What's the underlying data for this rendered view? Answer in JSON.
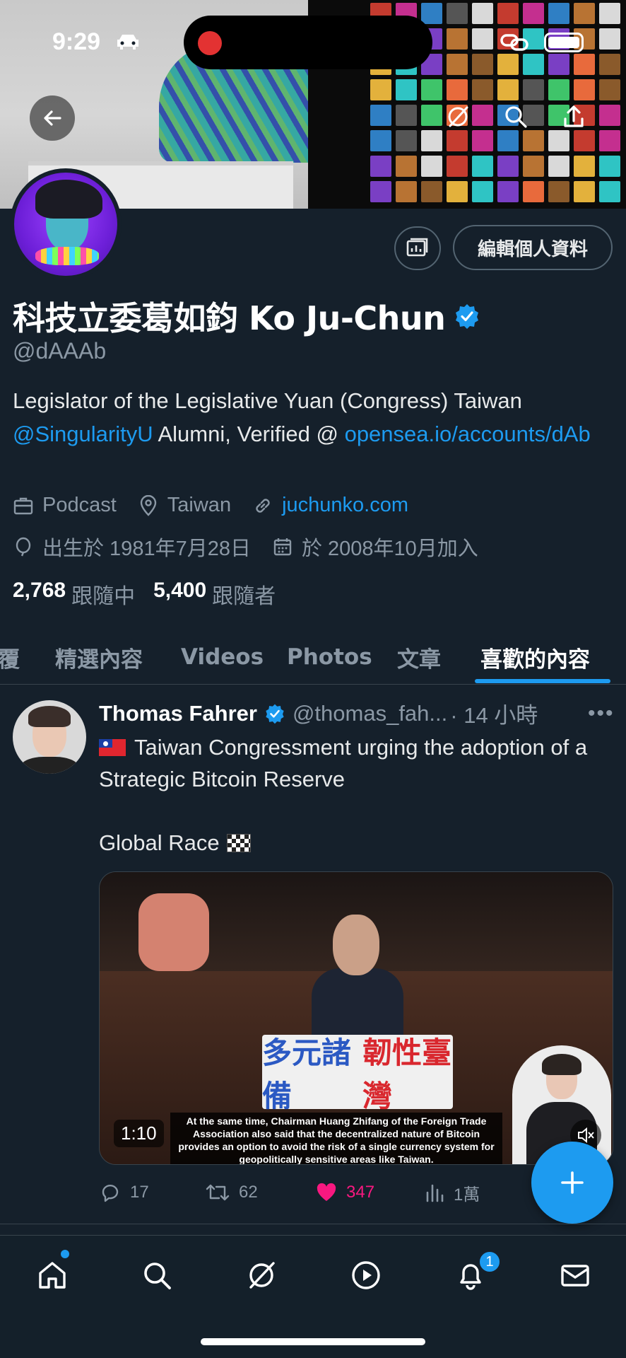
{
  "status_bar": {
    "time": "9:29"
  },
  "profile": {
    "name": "科技立委葛如鈞 Ko Ju-Chun",
    "handle": "@dAAAb",
    "edit_label": "編輯個人資料",
    "bio_part1": "Legislator of the Legislative Yuan (Congress) Taiwan ",
    "bio_mention": "@SingularityU",
    "bio_part2": " Alumni, Verified @ ",
    "bio_link": "opensea.io/accounts/dAb",
    "category": "Podcast",
    "location": "Taiwan",
    "website": "juchunko.com",
    "birthday": "出生於 1981年7月28日",
    "joined": "於 2008年10月加入",
    "following_count": "2,768",
    "following_label": "跟隨中",
    "followers_count": "5,400",
    "followers_label": "跟隨者"
  },
  "tabs": [
    "回覆",
    "精選內容",
    "Videos",
    "Photos",
    "文章",
    "喜歡的內容"
  ],
  "active_tab": "喜歡的內容",
  "tweet": {
    "author_name": "Thomas Fahrer",
    "author_handle": "@thomas_fah...",
    "time": "· 14 小時",
    "text_line1": "Taiwan Congressment urging the adoption of a Strategic Bitcoin Reserve",
    "text_line2": "Global Race",
    "video": {
      "duration": "1:10",
      "sign_left": "多元諸備",
      "sign_right": "韌性臺灣",
      "caption": "At the same time, Chairman Huang Zhifang of the Foreign Trade Association also said that the decentralized nature of Bitcoin provides an option to avoid the risk of a single currency system for geopolitically sensitive areas like Taiwan."
    },
    "replies": "17",
    "retweets": "62",
    "likes": "347",
    "views": "1萬"
  },
  "notifications_badge": "1",
  "colors": {
    "background": "#15202b",
    "accent": "#1d9bf0",
    "like": "#f91880",
    "muted": "#8b98a5"
  }
}
